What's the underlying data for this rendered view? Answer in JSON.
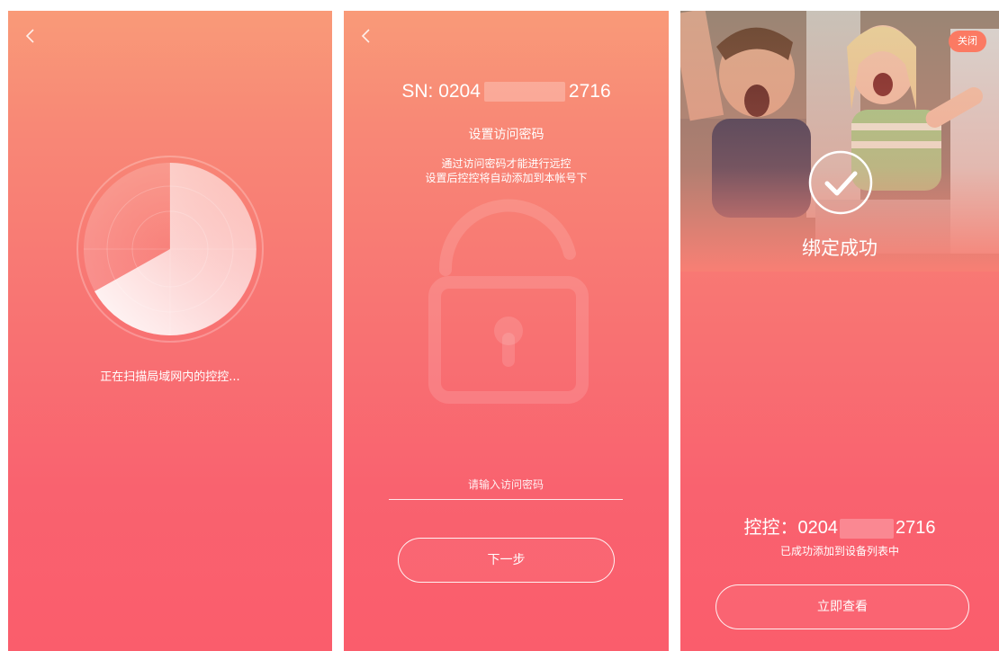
{
  "screen1": {
    "scan_text": "正在扫描局域网内的控控..."
  },
  "screen2": {
    "sn_prefix": "SN: 0204",
    "sn_suffix": "2716",
    "title": "设置访问密码",
    "desc_line1": "通过访问密码才能进行远控",
    "desc_line2": "设置后控控将自动添加到本帐号下",
    "password_placeholder": "请输入访问密码",
    "next_label": "下一步"
  },
  "screen3": {
    "close_label": "关闭",
    "bind_success": "绑定成功",
    "device_prefix": "控控：0204",
    "device_suffix": "2716",
    "added_text": "已成功添加到设备列表中",
    "view_label": "立即查看"
  },
  "icons": {
    "back": "chevron-left-icon",
    "check": "check-circle-icon",
    "lock": "unlocked-padlock-icon",
    "radar": "radar-scan-icon"
  },
  "colors": {
    "gradient_top": "#f99a78",
    "gradient_bottom": "#fa5d6c",
    "close_button": "#fb7a63"
  }
}
